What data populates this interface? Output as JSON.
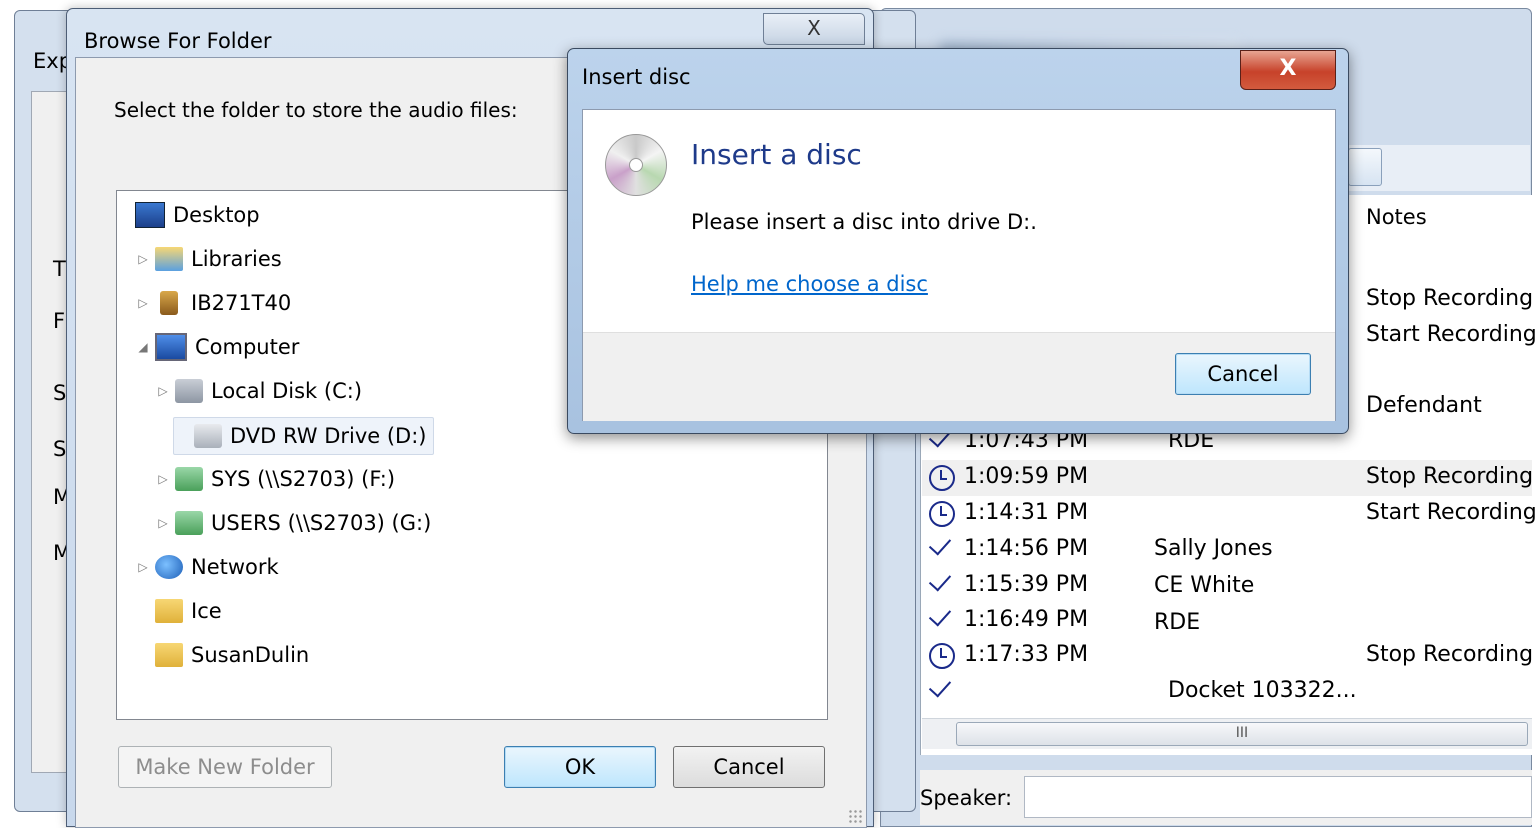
{
  "background_app": {
    "notes_header": "Notes",
    "rows": [
      {
        "type": "note",
        "time": "",
        "speaker": "",
        "note": "Stop Recording",
        "icon": "none"
      },
      {
        "type": "note",
        "time": "",
        "speaker": "",
        "note": "Start Recording",
        "icon": "none"
      },
      {
        "type": "note",
        "time": "",
        "speaker": "",
        "note": "Defendant",
        "icon": "none"
      },
      {
        "type": "entry",
        "time": "1:07:43 PM",
        "speaker": "RDE",
        "note": "",
        "icon": "check-icon"
      },
      {
        "type": "entry",
        "time": "1:09:59 PM",
        "speaker": "",
        "note": "Stop Recording",
        "icon": "clock-icon"
      },
      {
        "type": "entry",
        "time": "1:14:31 PM",
        "speaker": "",
        "note": "Start Recording",
        "icon": "clock-icon"
      },
      {
        "type": "entry",
        "time": "1:14:56 PM",
        "speaker": "Sally Jones",
        "note": "",
        "icon": "check-icon"
      },
      {
        "type": "entry",
        "time": "1:15:39 PM",
        "speaker": "CE White",
        "note": "",
        "icon": "check-icon"
      },
      {
        "type": "entry",
        "time": "1:16:49 PM",
        "speaker": "RDE",
        "note": "",
        "icon": "check-icon"
      },
      {
        "type": "entry",
        "time": "1:17:33 PM",
        "speaker": "",
        "note": "Stop Recording",
        "icon": "clock-icon"
      },
      {
        "type": "entry",
        "time": "",
        "speaker": "Docket 103322...",
        "note": "",
        "icon": "check-icon"
      }
    ],
    "scroll_grip": "III",
    "speaker_label": "Speaker:"
  },
  "exp_window": {
    "title": "Exp",
    "side_letters": [
      "T",
      "F",
      "S",
      "S",
      "M",
      "M"
    ]
  },
  "browse": {
    "title": "Browse For Folder",
    "close_glyph": "X",
    "prompt": "Select the folder to store the audio files:",
    "tree": [
      {
        "label": "Desktop",
        "icon": "desktop-icon",
        "arrow": ""
      },
      {
        "label": "Libraries",
        "icon": "libraries-icon",
        "arrow": "▷"
      },
      {
        "label": "IB271T40",
        "icon": "user-folder-icon",
        "arrow": "▷"
      },
      {
        "label": "Computer",
        "icon": "computer-icon",
        "arrow": "◢"
      },
      {
        "label": "Local Disk (C:)",
        "icon": "local-disk-icon",
        "arrow": "▷"
      },
      {
        "label": "DVD RW Drive (D:)",
        "icon": "dvd-drive-icon",
        "arrow": ""
      },
      {
        "label": "SYS (\\\\S2703) (F:)",
        "icon": "network-drive-icon",
        "arrow": "▷"
      },
      {
        "label": "USERS (\\\\S2703) (G:)",
        "icon": "network-drive-icon",
        "arrow": "▷"
      },
      {
        "label": "Network",
        "icon": "network-icon",
        "arrow": "▷"
      },
      {
        "label": "Ice",
        "icon": "folder-icon",
        "arrow": ""
      },
      {
        "label": "SusanDulin",
        "icon": "folder-icon",
        "arrow": ""
      }
    ],
    "make_new_folder": "Make New Folder",
    "ok": "OK",
    "cancel": "Cancel"
  },
  "insert_disc": {
    "title": "Insert disc",
    "close_glyph": "X",
    "heading": "Insert a disc",
    "message": "Please insert a disc into drive D:.",
    "help_link": "Help me choose a disc",
    "cancel": "Cancel"
  }
}
